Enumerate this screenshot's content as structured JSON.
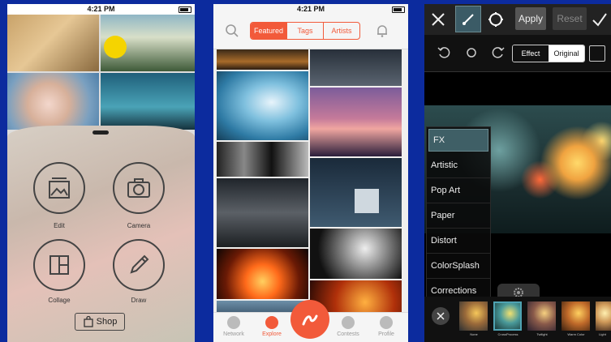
{
  "status_bar": {
    "time": "4:21 PM"
  },
  "screen1": {
    "menu": [
      {
        "id": "edit",
        "label": "Edit",
        "icon": "edit-photo-icon"
      },
      {
        "id": "camera",
        "label": "Camera",
        "icon": "camera-icon"
      },
      {
        "id": "collage",
        "label": "Collage",
        "icon": "collage-icon"
      },
      {
        "id": "draw",
        "label": "Draw",
        "icon": "pencil-icon"
      }
    ],
    "shop_label": "Shop"
  },
  "screen2": {
    "segments": [
      "Featured",
      "Tags",
      "Artists"
    ],
    "active_segment": "Featured",
    "tabs": [
      "Network",
      "Explore",
      "",
      "Contests",
      "Profile"
    ],
    "active_tab": "Explore",
    "accent": "#f25a3a"
  },
  "screen3": {
    "apply_label": "Apply",
    "reset_label": "Reset",
    "effect_label": "Effect",
    "original_label": "Original",
    "effects": [
      "FX",
      "Artistic",
      "Pop Art",
      "Paper",
      "Distort",
      "ColorSplash",
      "Corrections"
    ],
    "selected_effect": "FX",
    "filters": [
      "None",
      "CrossProcess",
      "Twilight",
      "Warm Color",
      "Light"
    ]
  }
}
